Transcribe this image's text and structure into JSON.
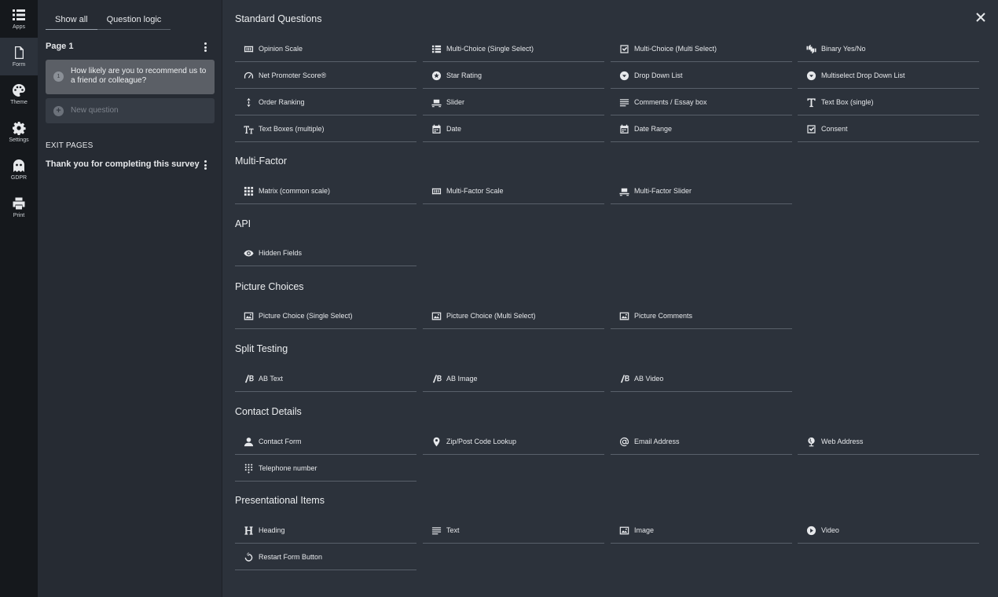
{
  "rail": {
    "items": [
      {
        "label": "Apps",
        "icon": "apps-icon"
      },
      {
        "label": "Form",
        "icon": "form-icon"
      },
      {
        "label": "Theme",
        "icon": "palette-icon"
      },
      {
        "label": "Settings",
        "icon": "gear-icon"
      },
      {
        "label": "GDPR",
        "icon": "ghost-icon"
      },
      {
        "label": "Print",
        "icon": "printer-icon"
      }
    ]
  },
  "panel": {
    "tabs": [
      "Show all",
      "Question logic"
    ],
    "page_title": "Page 1",
    "question": {
      "number": "1",
      "text": "How likely are you to recommend us to a friend or colleague?"
    },
    "new_question_placeholder": "New question",
    "exit_pages_heading": "EXIT PAGES",
    "exit_item": "Thank you for completing this survey"
  },
  "sections": [
    {
      "title": "Standard Questions",
      "items": [
        {
          "label": "Opinion Scale",
          "icon": "scale-icon"
        },
        {
          "label": "Multi-Choice (Single Select)",
          "icon": "list-icon"
        },
        {
          "label": "Multi-Choice (Multi Select)",
          "icon": "checkbox-icon"
        },
        {
          "label": "Binary Yes/No",
          "icon": "thumbs-icon"
        },
        {
          "label": "Net Promoter Score®",
          "icon": "gauge-icon"
        },
        {
          "label": "Star Rating",
          "icon": "star-icon"
        },
        {
          "label": "Drop Down List",
          "icon": "dropdown-icon"
        },
        {
          "label": "Multiselect Drop Down List",
          "icon": "dropdown-icon"
        },
        {
          "label": "Order Ranking",
          "icon": "sort-icon"
        },
        {
          "label": "Slider",
          "icon": "slider-icon"
        },
        {
          "label": "Comments / Essay box",
          "icon": "lines-icon"
        },
        {
          "label": "Text Box (single)",
          "icon": "text-t-icon"
        },
        {
          "label": "Text Boxes (multiple)",
          "icon": "text-tt-icon"
        },
        {
          "label": "Date",
          "icon": "calendar-icon"
        },
        {
          "label": "Date Range",
          "icon": "calendar-icon"
        },
        {
          "label": "Consent",
          "icon": "checkbox-icon"
        }
      ]
    },
    {
      "title": "Multi-Factor",
      "items": [
        {
          "label": "Matrix (common scale)",
          "icon": "grid-icon"
        },
        {
          "label": "Multi-Factor Scale",
          "icon": "scale-icon"
        },
        {
          "label": "Multi-Factor Slider",
          "icon": "slider-icon"
        }
      ]
    },
    {
      "title": "API",
      "items": [
        {
          "label": "Hidden Fields",
          "icon": "eye-icon"
        }
      ]
    },
    {
      "title": "Picture Choices",
      "items": [
        {
          "label": "Picture Choice (Single Select)",
          "icon": "picture-icon"
        },
        {
          "label": "Picture Choice (Multi Select)",
          "icon": "picture-icon"
        },
        {
          "label": "Picture Comments",
          "icon": "picture-icon"
        }
      ]
    },
    {
      "title": "Split Testing",
      "items": [
        {
          "label": "AB Text",
          "icon": "ab-icon"
        },
        {
          "label": "AB Image",
          "icon": "ab-icon"
        },
        {
          "label": "AB Video",
          "icon": "ab-icon"
        }
      ]
    },
    {
      "title": "Contact Details",
      "items": [
        {
          "label": "Contact Form",
          "icon": "person-icon"
        },
        {
          "label": "Zip/Post Code Lookup",
          "icon": "pin-icon"
        },
        {
          "label": "Email Address",
          "icon": "at-icon"
        },
        {
          "label": "Web Address",
          "icon": "globe-icon"
        },
        {
          "label": "Telephone number",
          "icon": "keypad-icon"
        }
      ]
    },
    {
      "title": "Presentational Items",
      "items": [
        {
          "label": "Heading",
          "icon": "heading-icon"
        },
        {
          "label": "Text",
          "icon": "lines-icon"
        },
        {
          "label": "Image",
          "icon": "picture-icon"
        },
        {
          "label": "Video",
          "icon": "play-icon"
        },
        {
          "label": "Restart Form Button",
          "icon": "restart-icon"
        }
      ]
    }
  ]
}
